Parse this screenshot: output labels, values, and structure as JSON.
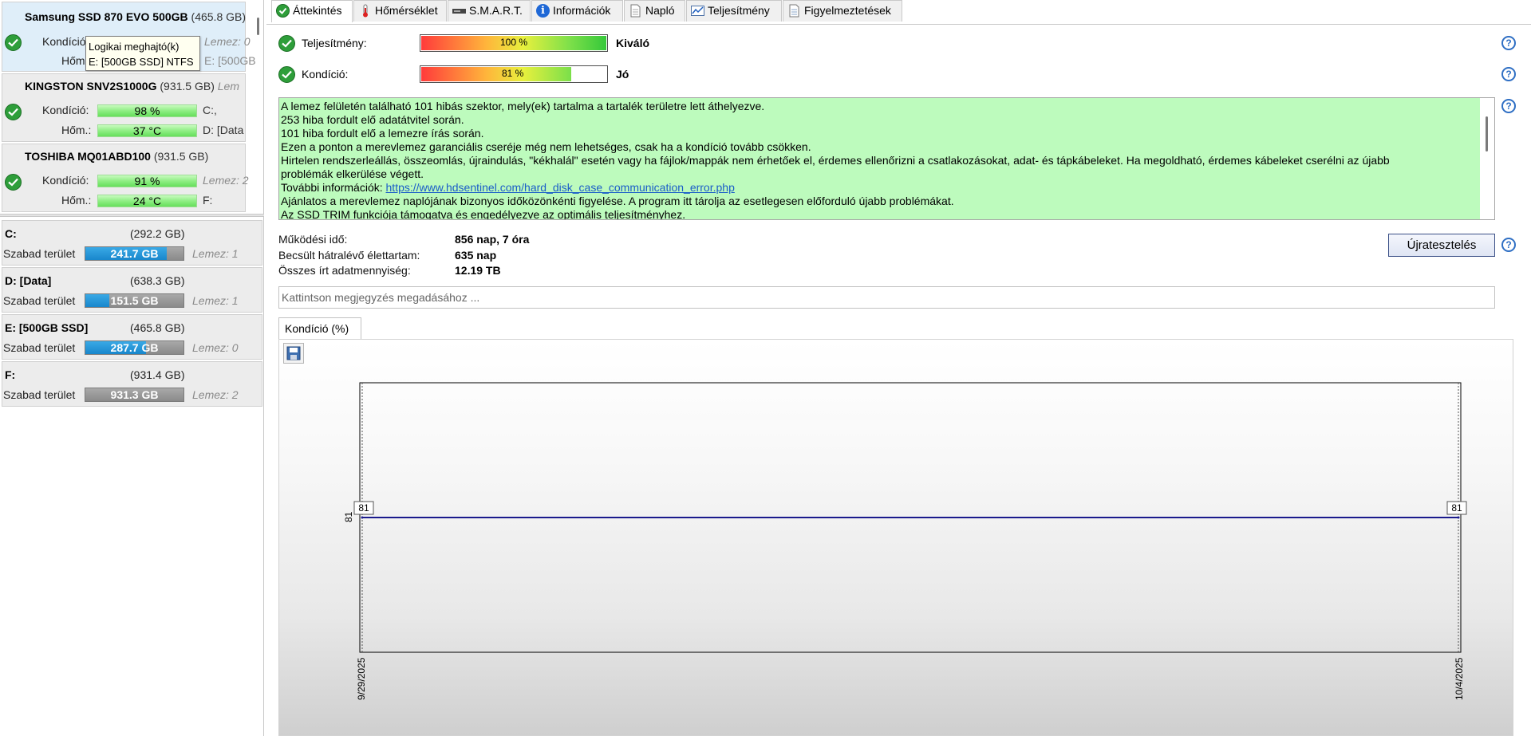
{
  "disks": [
    {
      "name": "Samsung SSD 870 EVO 500GB",
      "size": "(465.8 GB)",
      "kond_label": "Kondíció:",
      "hom_label": "Hőm.:",
      "right1": "Lemez: 0",
      "right2": "E: [500GB"
    },
    {
      "name": "KINGSTON SNV2S1000G",
      "size": "(931.5 GB)",
      "kond_label": "Kondíció:",
      "hom_label": "Hőm.:",
      "health": "98 %",
      "temp": "37 °C",
      "tail": "Lem",
      "right1": "C:,",
      "right2": "D: [Data"
    },
    {
      "name": "TOSHIBA MQ01ABD100",
      "size": "(931.5 GB)",
      "kond_label": "Kondíció:",
      "hom_label": "Hőm.:",
      "health": "91 %",
      "temp": "24 °C",
      "right1": "Lemez: 2",
      "right2": "F:"
    }
  ],
  "tooltip": {
    "line1": "Logikai meghajtó(k)",
    "line2": "E: [500GB SSD] NTFS"
  },
  "volumes": [
    {
      "name": "C:",
      "size": "(292.2 GB)",
      "free_label": "Szabad terület",
      "free": "241.7 GB",
      "free_fraction": 0.83,
      "disk": "Lemez: 1"
    },
    {
      "name": "D: [Data]",
      "size": "(638.3 GB)",
      "free_label": "Szabad terület",
      "free": "151.5 GB",
      "free_fraction": 0.24,
      "disk": "Lemez: 1"
    },
    {
      "name": "E: [500GB SSD]",
      "size": "(465.8 GB)",
      "free_label": "Szabad terület",
      "free": "287.7 GB",
      "free_fraction": 0.62,
      "disk": "Lemez: 0"
    },
    {
      "name": "F:",
      "size": "(931.4 GB)",
      "free_label": "Szabad terület",
      "free": "931.3 GB",
      "free_fraction": 1.0,
      "disk": "Lemez: 2"
    }
  ],
  "tabs": [
    "Áttekintés",
    "Hőmérséklet",
    "S.M.A.R.T.",
    "Információk",
    "Napló",
    "Teljesítmény",
    "Figyelmeztetések"
  ],
  "overview": {
    "performance_label": "Teljesítmény:",
    "performance_value": "100 %",
    "performance_fraction": 1.0,
    "performance_rating": "Kiváló",
    "condition_label": "Kondíció:",
    "condition_value": "81 %",
    "condition_fraction": 0.81,
    "condition_rating": "Jó",
    "messages": [
      "A lemez felületén található 101 hibás szektor, mely(ek) tartalma a tartalék területre lett áthelyezve.",
      "253 hiba fordult elő adatátvitel során.",
      "101 hiba fordult elő a lemezre írás során.",
      "Ezen a ponton a merevlemez garanciális cseréje még nem lehetséges, csak ha a kondíció tovább csökken.",
      "Hirtelen rendszerleállás, összeomlás, újraindulás, \"kékhalál\" esetén vagy ha fájlok/mappák nem érhetőek el, érdemes ellenőrizni a csatlakozásokat, adat- és tápkábeleket. Ha megoldható, érdemes kábeleket cserélni az újabb",
      "problémák elkerülése végett."
    ],
    "more_info_label": "További információk:",
    "more_info_link": "https://www.hdsentinel.com/hard_disk_case_communication_error.php",
    "messages_after": [
      "Ajánlatos a merevlemez naplójának bizonyos időközönkénti figyelése. A program itt tárolja az esetlegesen előforduló újabb problémákat.",
      "Az SSD TRIM funkciója támogatva és engedélyezve az optimális teljesítményhez."
    ],
    "uptime_label": "Működési idő:",
    "uptime_value": "856 nap, 7 óra",
    "lifetime_label": "Becsült hátralévő élettartam:",
    "lifetime_value": "635 nap",
    "written_label": "Összes írt adatmennyiség:",
    "written_value": "12.19 TB",
    "retest_label": "Újratesztelés",
    "note_placeholder": "Kattintson megjegyzés megadásához ..."
  },
  "chart_tab": "Kondíció  (%)",
  "chart_data": {
    "type": "line",
    "x": [
      "9/29/2025",
      "10/4/2025"
    ],
    "series": [
      {
        "values": [
          81,
          81
        ],
        "color": "#1a1a8c"
      }
    ],
    "ylabel": "81",
    "point_labels": [
      "81",
      "81"
    ]
  }
}
